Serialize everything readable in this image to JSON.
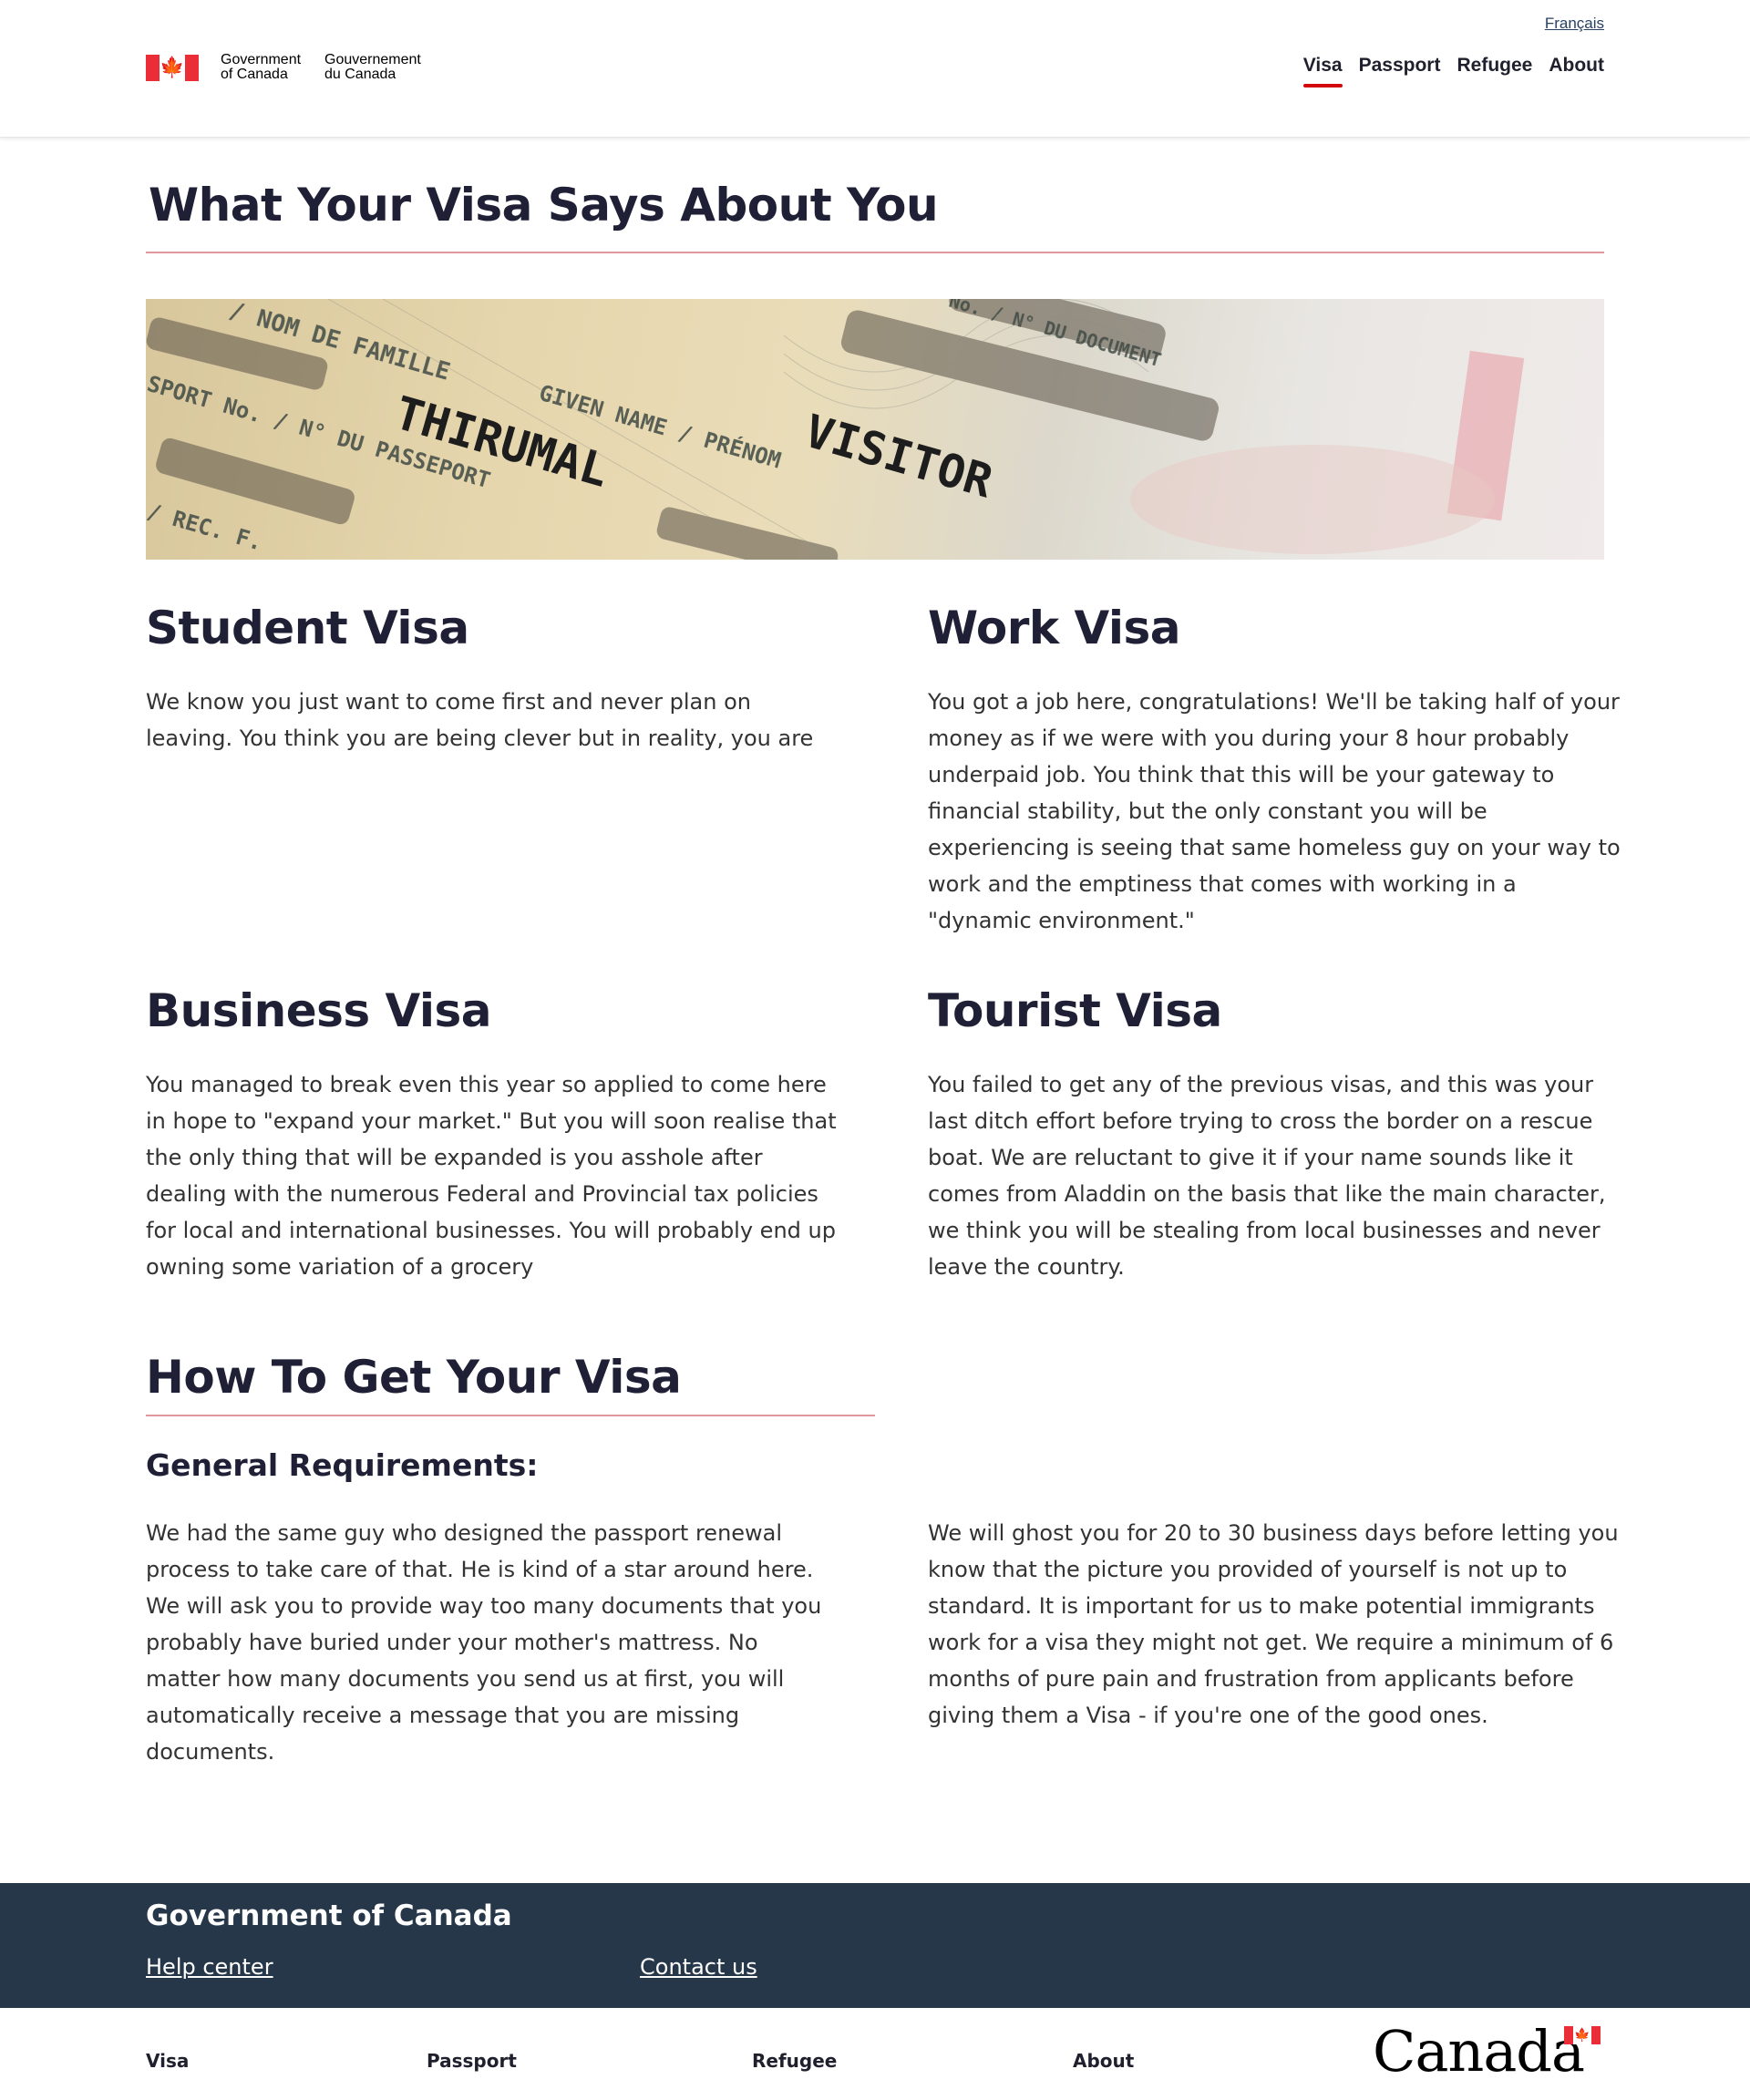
{
  "header": {
    "language_link": "Français",
    "signature_en": [
      "Government",
      "of Canada"
    ],
    "signature_fr": [
      "Gouvernement",
      "du Canada"
    ],
    "flag_icon": "canada-flag-icon",
    "nav": [
      {
        "label": "Visa",
        "active": true
      },
      {
        "label": "Passport",
        "active": false
      },
      {
        "label": "Refugee",
        "active": false
      },
      {
        "label": "About",
        "active": false
      }
    ],
    "accent_color": "#d3080c"
  },
  "main": {
    "title": "What Your Visa Says About You",
    "hero_text": [
      "/ NOM DE FAMILLE",
      "GIVEN NAME / PRÉNOM",
      "THIRUMAL",
      "VISITOR",
      "SPORT No. / N° DU PASSEPORT",
      "/ REC. F.",
      "No. / N° DU DOCUMENT"
    ],
    "visas": [
      {
        "title": "Student Visa",
        "text": "We know you just want to come first and never plan on leaving. You think you are being clever but in reality, you are"
      },
      {
        "title": "Work Visa",
        "text": "You got a job here, congratulations! We'll be taking half of your money as if we were with you during your 8 hour probably underpaid job. You think that this will be your gateway to financial stability, but the only constant you will be experiencing is seeing that same homeless guy on your way to work and the emptiness that comes with working in a \"dynamic environment.\""
      },
      {
        "title": "Business Visa",
        "text": "You managed to break even this year so applied to come here in hope to \"expand your market.\" But you will soon realise that the only thing that will be expanded is you asshole after dealing with the numerous Federal and Provincial tax policies for local and international businesses. You will probably end up owning some variation of a grocery"
      },
      {
        "title": "Tourist Visa",
        "text": "You failed to get any of the previous visas, and this was your last ditch effort before trying to cross the border on a rescue boat. We are reluctant to give it if your name sounds like it comes from Aladdin on the basis that like the main character, we think you will be stealing from local businesses and never leave the country."
      }
    ],
    "how_to": {
      "title": "How To Get Your Visa",
      "subheading": "General Requirements:",
      "left_text": "We had the same guy who designed the passport renewal process to take care of that. He is kind of a star around here. We will ask you to provide way too many documents that you probably have buried under your mother's mattress. No matter how many documents you send us at first, you will automatically receive a message that you are missing documents.",
      "right_text": "We will ghost you for 20 to 30 business days before letting you know that the picture you provided of yourself is not up to standard. It is important for us to make potential immigrants work for a visa they might not get. We require a minimum of 6 months of pure pain and frustration from applicants before giving them a Visa - if you're one of the good ones."
    }
  },
  "footer": {
    "title": "Government of Canada",
    "links": [
      "Help center",
      "Contact us"
    ],
    "bottom_links": [
      "Visa",
      "Passport",
      "Refugee",
      "About"
    ],
    "wordmark": "Canada",
    "background_color": "#26374a"
  }
}
